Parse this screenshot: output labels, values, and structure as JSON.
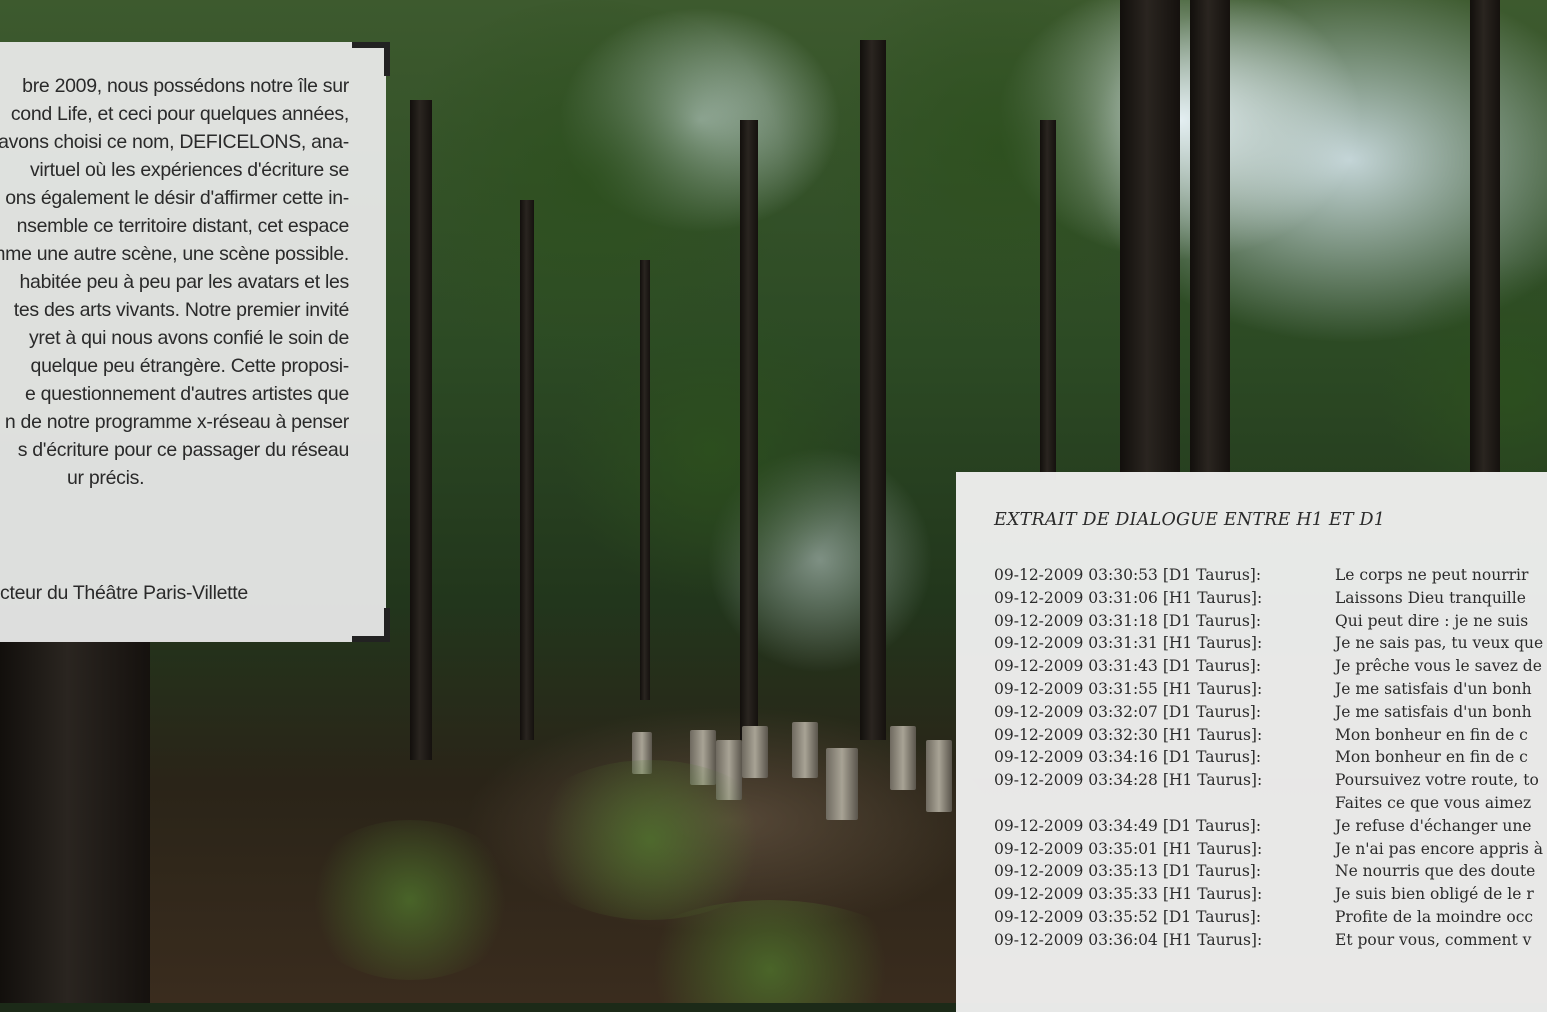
{
  "intro": {
    "lines": [
      "bre 2009, nous possédons notre île sur",
      "cond Life, et ceci pour quelques années,",
      "avons choisi ce nom, DEFICELONS, ana-",
      "virtuel où les expériences d'écriture se",
      "ons également le désir d'affirmer cette in-",
      "nsemble ce territoire distant, cet espace",
      "mme une autre scène, une scène possible.",
      "habitée peu à peu par les avatars et les",
      "tes des arts vivants. Notre premier invité",
      "yret à qui nous avons confié le soin de",
      "quelque peu étrangère. Cette proposi-",
      "e questionnement d'autres artistes que",
      "n de notre programme x-réseau à penser",
      "s d'écriture pour ce passager du réseau",
      "ur précis."
    ],
    "signature": "cteur du Théâtre Paris-Villette"
  },
  "dialogue": {
    "title": "EXTRAIT DE DIALOGUE ENTRE H1 ET D1",
    "rows": [
      {
        "stamp": "09-12-2009 03:30:53 [D1 Taurus]:",
        "line": "Le corps ne peut nourrir"
      },
      {
        "stamp": "09-12-2009 03:31:06 [H1 Taurus]:",
        "line": "Laissons Dieu tranquille"
      },
      {
        "stamp": "09-12-2009 03:31:18 [D1 Taurus]:",
        "line": "Qui peut dire : je ne suis"
      },
      {
        "stamp": "09-12-2009 03:31:31 [H1 Taurus]:",
        "line": "Je ne sais pas, tu veux que"
      },
      {
        "stamp": "09-12-2009 03:31:43 [D1 Taurus]:",
        "line": "Je prêche vous le savez de"
      },
      {
        "stamp": "09-12-2009 03:31:55 [H1 Taurus]:",
        "line": "Je me satisfais d'un bonh"
      },
      {
        "stamp": "09-12-2009 03:32:07 [D1 Taurus]:",
        "line": "Je me satisfais d'un bonh"
      },
      {
        "stamp": "09-12-2009 03:32:30 [H1 Taurus]:",
        "line": "Mon bonheur en fin de c"
      },
      {
        "stamp": "09-12-2009 03:34:16 [D1 Taurus]:",
        "line": "Mon bonheur en fin de c"
      },
      {
        "stamp": "09-12-2009 03:34:28 [H1 Taurus]:",
        "line": "Poursuivez votre route, to"
      },
      {
        "stamp": "",
        "line": "Faites ce que vous aimez"
      },
      {
        "stamp": "09-12-2009 03:34:49 [D1 Taurus]:",
        "line": "Je refuse d'échanger une"
      },
      {
        "stamp": "09-12-2009 03:35:01 [H1 Taurus]:",
        "line": "Je n'ai pas encore appris à"
      },
      {
        "stamp": "09-12-2009 03:35:13 [D1 Taurus]:",
        "line": "Ne nourris que des doute"
      },
      {
        "stamp": "09-12-2009 03:35:33 [H1 Taurus]:",
        "line": "Je suis bien obligé de le r"
      },
      {
        "stamp": "09-12-2009 03:35:52 [D1 Taurus]:",
        "line": "Profite de la moindre occ"
      },
      {
        "stamp": "09-12-2009 03:36:04 [H1 Taurus]:",
        "line": "Et pour vous, comment v"
      }
    ]
  }
}
